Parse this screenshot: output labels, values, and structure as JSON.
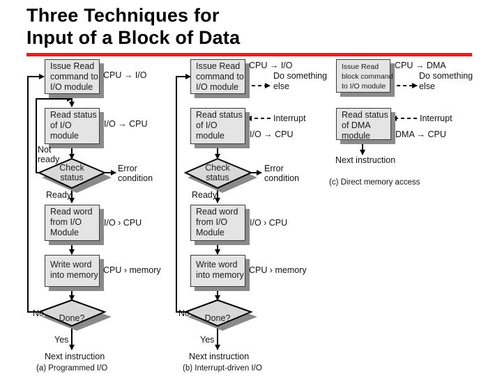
{
  "title": {
    "line1": "Three Techniques for",
    "line2": "Input of a Block of Data"
  },
  "colors": {
    "accent_rule": "#ee1c1c",
    "box_fill": "#e4e4e4",
    "box_shadow": "#8a8a8a"
  },
  "panel_a": {
    "caption": "(a) Programmed I/O",
    "issue_read": [
      "Issue Read",
      "command to",
      "I/O module"
    ],
    "issue_read_flow": "CPU → I/O",
    "read_status": [
      "Read status",
      "of I/O",
      "module"
    ],
    "read_status_flow": "I/O → CPU",
    "not_ready": [
      "Not",
      "ready"
    ],
    "check_status": [
      "Check",
      "status"
    ],
    "error": [
      "Error",
      "condition"
    ],
    "ready": "Ready",
    "read_word": [
      "Read word",
      "from I/O",
      "Module"
    ],
    "read_word_flow": "I/O   › CPU",
    "write_word": [
      "Write word",
      "into memory"
    ],
    "write_word_flow": "CPU   › memory",
    "no": "No",
    "done": "Done?",
    "yes": "Yes",
    "next": "Next instruction"
  },
  "panel_b": {
    "caption": "(b) Interrupt-driven I/O",
    "issue_read": [
      "Issue Read",
      "command to",
      "I/O module"
    ],
    "issue_read_flow": "CPU → I/O",
    "do_something": [
      "Do something",
      "else"
    ],
    "interrupt": "Interrupt",
    "read_status": [
      "Read status",
      "of I/O",
      "module"
    ],
    "read_status_flow": "I/O → CPU",
    "check_status": [
      "Check",
      "status"
    ],
    "error": [
      "Error",
      "condition"
    ],
    "ready": "Ready",
    "read_word": [
      "Read word",
      "from I/O",
      "Module"
    ],
    "read_word_flow": "I/O   › CPU",
    "write_word": [
      "Write word",
      "into memory"
    ],
    "write_word_flow": "CPU   › memory",
    "no": "No",
    "done": "Done?",
    "yes": "Yes",
    "next": "Next instruction"
  },
  "panel_c": {
    "caption": "(c) Direct memory access",
    "issue_read": [
      "Issue Read",
      "block command",
      "to I/O module"
    ],
    "issue_read_flow": "CPU → DMA",
    "do_something": [
      "Do something",
      "else"
    ],
    "interrupt": "Interrupt",
    "read_status": [
      "Read status",
      "of DMA",
      "module"
    ],
    "read_status_flow": "DMA → CPU",
    "next": "Next instruction"
  }
}
